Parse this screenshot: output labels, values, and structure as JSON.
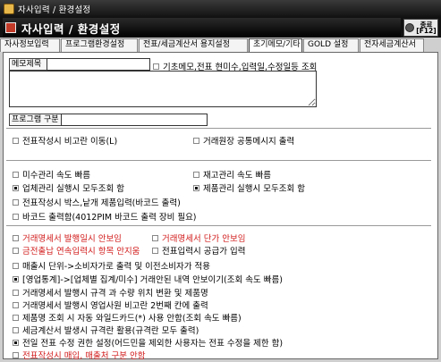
{
  "window": {
    "title": "자사입력 / 환경설정"
  },
  "header": {
    "title": "자사입력 / 환경설정",
    "exit_label": "종료",
    "exit_shortcut": "[F12]"
  },
  "tabs": [
    {
      "label": "자사정보입력",
      "active": false
    },
    {
      "label": "프로그램환경설정",
      "active": false
    },
    {
      "label": "전표/세금계산서 용지설정",
      "active": false
    },
    {
      "label": "초기메모/기타",
      "active": true
    },
    {
      "label": "GOLD 설정",
      "active": false
    },
    {
      "label": "전자세금계산서",
      "active": false
    }
  ],
  "memo": {
    "title_label": "메모제목",
    "title_value": "",
    "basic_memo_label": "기초메모,전표 현미수,입력일,수정일등 조회",
    "basic_memo_checked": false,
    "body_value": "",
    "program_division_label": "프로그램 구분",
    "program_division_value": ""
  },
  "options_a": [
    {
      "label": "전표작성시 비고란 이동(L)",
      "checked": false
    },
    {
      "label": "거래원장 공통메시지 출력",
      "checked": false
    }
  ],
  "options_b": [
    {
      "label": "미수관리 속도 빠름",
      "checked": false
    },
    {
      "label": "재고관리 속도 빠름",
      "checked": false
    },
    {
      "label": "업체관리 실행시 모두조회 함",
      "checked": true
    },
    {
      "label": "제품관리 실행시 모두조회 함",
      "checked": true
    },
    {
      "label": "전표작성시 박스,낱개 제품입력(바코드 출력)",
      "checked": false
    },
    {
      "label": "바코드 출력함(4012PIM 바코드 출력 장비 필요)",
      "checked": false
    }
  ],
  "options_c": [
    {
      "label": "거래명세서 발행일시 안보임",
      "checked": false,
      "red": true
    },
    {
      "label": "거래명세서 단가 안보임",
      "checked": false,
      "red": true
    },
    {
      "label": "금전출납 연속입력시 항목 안지움",
      "checked": false,
      "red": true
    },
    {
      "label": "전표입력시 공급가 입력",
      "checked": false,
      "red": false
    },
    {
      "label": "매출시 단위->소비자가로 출력 및 이전소비자가 적용",
      "checked": false,
      "red": false
    },
    {
      "label": "[영업통계]->[업체별 집계/미수] 거래안된 내역 안보이기(조회 속도 빠름)",
      "checked": true,
      "red": false
    },
    {
      "label": "거래명세서 발행시 규격 과 수량 위치 변환 및 제품명",
      "checked": false,
      "red": false
    },
    {
      "label": "거래명세서 발행시 영업사원 비고란 2번째 칸에 출력",
      "checked": false,
      "red": false
    },
    {
      "label": "제품명 조회 시 자동 와일드카드(*) 사용 안함(조회 속도 빠름)",
      "checked": false,
      "red": false
    },
    {
      "label": "세금계산서 발생시 규격란 활용(규격란 모두 출력)",
      "checked": false,
      "red": false
    },
    {
      "label": "전일 전표 수정 권한 설정(어드민을 제외한 사용자는 전표 수정을 제한 함)",
      "checked": true,
      "red": false
    },
    {
      "label": "전표작성시 매입, 매출처 구분 안함",
      "checked": false,
      "red": true
    }
  ]
}
